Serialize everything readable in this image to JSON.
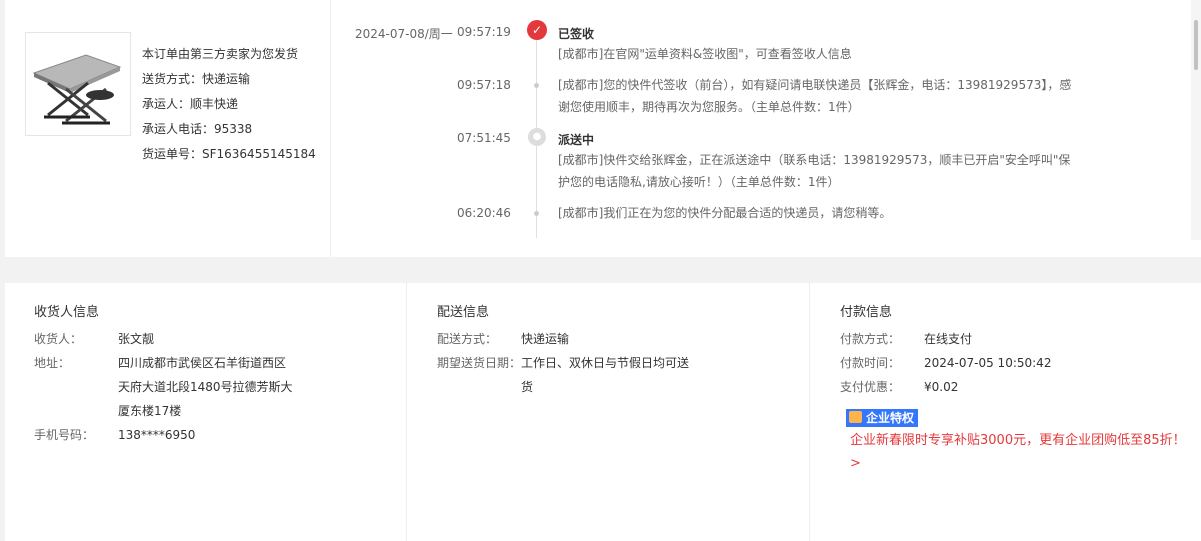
{
  "product": {
    "lines": [
      "本订单由第三方卖家为您发货",
      "送货方式：快递运输",
      "承运人：顺丰快递",
      "承运人电话：95338",
      "货运单号：SF1636455145184"
    ]
  },
  "timeline": {
    "date": "2024-07-08/周一",
    "entries": [
      {
        "time": "09:57:19",
        "title": "已签收",
        "text": "[成都市]在官网\"运单资料&签收图\"，可查看签收人信息",
        "icon": "check-icon"
      },
      {
        "time": "09:57:18",
        "title": "",
        "text": "[成都市]您的快件代签收（前台），如有疑问请电联快递员【张辉金，电话：13981929573】，感谢您使用顺丰，期待再次为您服务。（主单总件数：1件）",
        "icon": "dot"
      },
      {
        "time": "07:51:45",
        "title": "派送中",
        "text": "[成都市]快件交给张辉金，正在派送途中（联系电话：13981929573，顺丰已开启\"安全呼叫\"保护您的电话隐私,请放心接听！）（主单总件数：1件）",
        "icon": "truck-icon"
      },
      {
        "time": "06:20:46",
        "title": "",
        "text": "[成都市]我们正在为您的快件分配最合适的快递员，请您稍等。",
        "icon": "dot"
      }
    ]
  },
  "consignee": {
    "title": "收货人信息",
    "name_label": "收货人：",
    "name": "张文靓",
    "addr_label": "地址：",
    "addr_lines": [
      "四川成都市武侯区石羊街道西区",
      "天府大道北段1480号拉德芳斯大",
      "厦东楼17楼"
    ],
    "phone_label": "手机号码：",
    "phone": "138****6950"
  },
  "delivery": {
    "title": "配送信息",
    "method_label": "配送方式：",
    "method": "快递运输",
    "date_label": "期望送货日期：",
    "date_lines": [
      "工作日、双休日与节假日均可送",
      "货"
    ]
  },
  "payment": {
    "title": "付款信息",
    "method_label": "付款方式：",
    "method": "在线支付",
    "time_label": "付款时间：",
    "time": "2024-07-05 10:50:42",
    "discount_label": "支付优惠：",
    "discount": "¥0.02",
    "badge": "企业特权",
    "promo_line1": "企业新春限时专享补贴3000元，更有企业团购低至85折！",
    "promo_line2": ">"
  },
  "colors": {
    "accent": "#e4393c",
    "badge": "#3377ff"
  }
}
